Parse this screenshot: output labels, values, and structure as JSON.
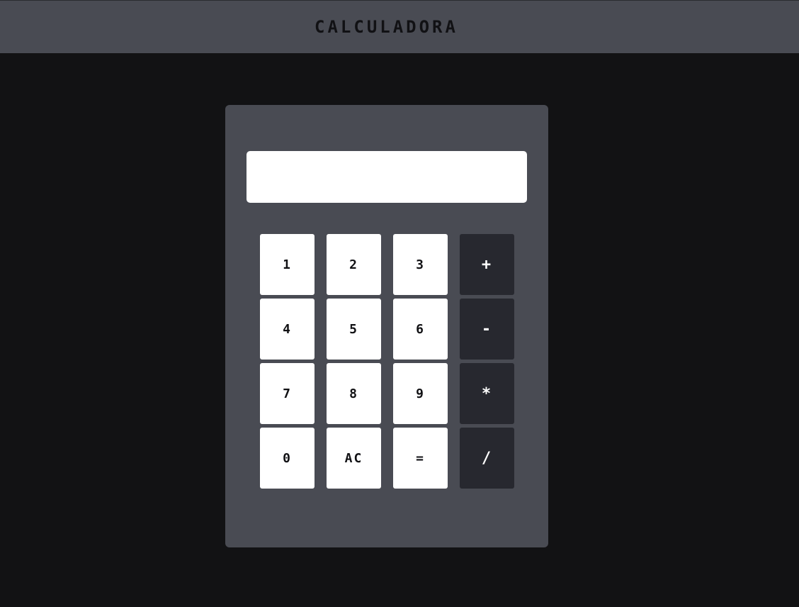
{
  "header": {
    "title": "CALCULADORA"
  },
  "display": {
    "value": ""
  },
  "keypad": {
    "keys": [
      {
        "label": "1"
      },
      {
        "label": "2"
      },
      {
        "label": "3"
      },
      {
        "label": "+"
      },
      {
        "label": "4"
      },
      {
        "label": "5"
      },
      {
        "label": "6"
      },
      {
        "label": "-"
      },
      {
        "label": "7"
      },
      {
        "label": "8"
      },
      {
        "label": "9"
      },
      {
        "label": "*"
      },
      {
        "label": "0"
      },
      {
        "label": "AC"
      },
      {
        "label": "="
      },
      {
        "label": "/"
      }
    ]
  },
  "colors": {
    "page_background": "#121214",
    "header_background": "#494b53",
    "calculator_body": "#494b53",
    "digit_key": "#ffffff",
    "operator_key": "#27282f"
  }
}
